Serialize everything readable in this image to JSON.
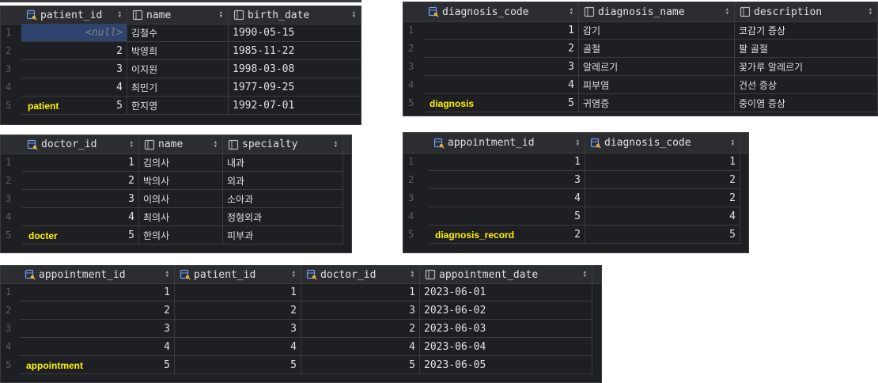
{
  "tables": [
    {
      "label": "patient",
      "columns": [
        {
          "name": "patient_id",
          "icon": "key-column-icon",
          "align": "num"
        },
        {
          "name": "name",
          "icon": "column-icon",
          "align": "txt"
        },
        {
          "name": "birth_date",
          "icon": "column-icon",
          "align": "mono"
        }
      ],
      "rows": [
        [
          "1",
          "<null>",
          "김철수",
          "1990-05-15"
        ],
        [
          "2",
          "2",
          "박영희",
          "1985-11-22"
        ],
        [
          "3",
          "3",
          "이지원",
          "1998-03-08"
        ],
        [
          "4",
          "4",
          "최민기",
          "1977-09-25"
        ],
        [
          "5",
          "5",
          "한지영",
          "1992-07-01"
        ]
      ]
    },
    {
      "label": "diagnosis",
      "columns": [
        {
          "name": "diagnosis_code",
          "icon": "key-column-icon",
          "align": "num"
        },
        {
          "name": "diagnosis_name",
          "icon": "column-icon",
          "align": "txt"
        },
        {
          "name": "description",
          "icon": "column-icon",
          "align": "txt"
        }
      ],
      "rows": [
        [
          "1",
          "1",
          "감기",
          "코감기 증상"
        ],
        [
          "2",
          "2",
          "골절",
          "팔 골절"
        ],
        [
          "3",
          "3",
          "알레르기",
          "꽃가루 알레르기"
        ],
        [
          "4",
          "4",
          "피부염",
          "건선 증상"
        ],
        [
          "5",
          "5",
          "귀염증",
          "중이염 증상"
        ]
      ]
    },
    {
      "label": "docter",
      "columns": [
        {
          "name": "doctor_id",
          "icon": "key-column-icon",
          "align": "num"
        },
        {
          "name": "name",
          "icon": "column-icon",
          "align": "txt"
        },
        {
          "name": "specialty",
          "icon": "column-icon",
          "align": "txt"
        }
      ],
      "rows": [
        [
          "1",
          "1",
          "김의사",
          "내과"
        ],
        [
          "2",
          "2",
          "박의사",
          "외과"
        ],
        [
          "3",
          "3",
          "이의사",
          "소아과"
        ],
        [
          "4",
          "4",
          "최의사",
          "정형외과"
        ],
        [
          "5",
          "5",
          "한의사",
          "피부과"
        ]
      ]
    },
    {
      "label": "diagnosis_record",
      "columns": [
        {
          "name": "appointment_id",
          "icon": "key-column-icon",
          "align": "num"
        },
        {
          "name": "diagnosis_code",
          "icon": "key-column-icon",
          "align": "num"
        }
      ],
      "rows": [
        [
          "1",
          "1",
          "1"
        ],
        [
          "2",
          "3",
          "2"
        ],
        [
          "3",
          "4",
          "2"
        ],
        [
          "4",
          "5",
          "4"
        ],
        [
          "5",
          "2",
          "5"
        ]
      ]
    },
    {
      "label": "appointment",
      "columns": [
        {
          "name": "appointment_id",
          "icon": "key-column-icon",
          "align": "num"
        },
        {
          "name": "patient_id",
          "icon": "key-column-icon",
          "align": "num"
        },
        {
          "name": "doctor_id",
          "icon": "key-column-icon",
          "align": "num"
        },
        {
          "name": "appointment_date",
          "icon": "column-icon",
          "align": "mono"
        }
      ],
      "rows": [
        [
          "1",
          "1",
          "1",
          "1",
          "2023-06-01"
        ],
        [
          "2",
          "2",
          "2",
          "3",
          "2023-06-02"
        ],
        [
          "3",
          "3",
          "3",
          "2",
          "2023-06-03"
        ],
        [
          "4",
          "4",
          "4",
          "4",
          "2023-06-04"
        ],
        [
          "5",
          "5",
          "5",
          "5",
          "2023-06-05"
        ]
      ]
    }
  ],
  "colors": {
    "grid_bg": "#1e1f22",
    "header_bg": "#2b2d30",
    "selected_cell": "#2e436e",
    "label_yellow": "#fff200"
  }
}
